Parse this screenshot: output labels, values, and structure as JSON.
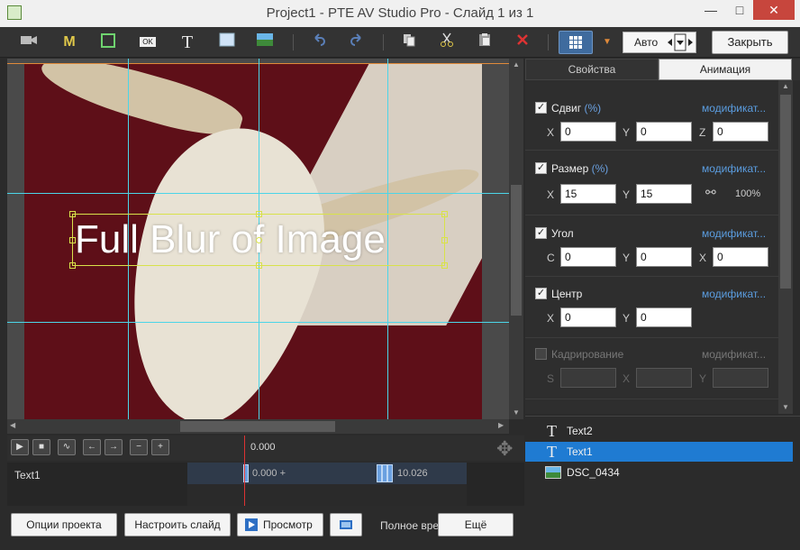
{
  "window": {
    "title": "Project1 - PTE AV Studio Pro - Слайд 1 из 1",
    "close_glyph": "✕",
    "minimize_glyph": "—",
    "maximize_glyph": "□"
  },
  "toolbar": {
    "icons": [
      "camera-icon",
      "mask-icon",
      "frame-icon",
      "ok-button-icon",
      "text-icon",
      "rectangle-icon",
      "image-icon",
      "undo-icon",
      "redo-icon",
      "copy-icon",
      "cut-icon",
      "paste-icon",
      "delete-icon",
      "grid-icon"
    ],
    "mask_glyph": "M",
    "text_glyph": "T",
    "ok_glyph": "OK",
    "mode_value": "Авто",
    "close_label": "Закрыть"
  },
  "canvas": {
    "text_object": "Full Blur of Image"
  },
  "tabs": [
    {
      "label": "Свойства",
      "active": false
    },
    {
      "label": "Анимация",
      "active": true
    }
  ],
  "props": {
    "modifier_label": "модификат...",
    "sections": [
      {
        "name": "pan",
        "label": "Сдвиг",
        "suffix": "(%)",
        "checked": true,
        "fields": [
          {
            "axis": "X",
            "value": "0"
          },
          {
            "axis": "Y",
            "value": "0"
          },
          {
            "axis": "Z",
            "value": "0"
          }
        ]
      },
      {
        "name": "zoom",
        "label": "Размер",
        "suffix": "(%)",
        "checked": true,
        "fields": [
          {
            "axis": "X",
            "value": "15"
          },
          {
            "axis": "Y",
            "value": "15"
          }
        ],
        "ratio": "100%"
      },
      {
        "name": "rotation",
        "label": "Угол",
        "suffix": "",
        "checked": true,
        "fields": [
          {
            "axis": "C",
            "value": "0"
          },
          {
            "axis": "Y",
            "value": "0"
          },
          {
            "axis": "X",
            "value": "0"
          }
        ]
      },
      {
        "name": "center",
        "label": "Центр",
        "suffix": "",
        "checked": true,
        "fields": [
          {
            "axis": "X",
            "value": "0"
          },
          {
            "axis": "Y",
            "value": "0"
          }
        ]
      },
      {
        "name": "crop",
        "label": "Кадрирование",
        "suffix": "",
        "checked": false,
        "fields": [
          {
            "axis": "S",
            "value": ""
          },
          {
            "axis": "X",
            "value": ""
          },
          {
            "axis": "Y",
            "value": ""
          }
        ]
      }
    ]
  },
  "layers": [
    {
      "name": "Text2",
      "type": "text",
      "selected": false
    },
    {
      "name": "Text1",
      "type": "text",
      "selected": true
    },
    {
      "name": "DSC_0434",
      "type": "image",
      "selected": false
    }
  ],
  "timeline": {
    "current_time": "0.000",
    "track_name": "Text1",
    "start_label": "0.000 +",
    "end_label": "10.026",
    "buttons": [
      "▶",
      "■",
      "∿",
      "←",
      "→",
      "−",
      "+"
    ]
  },
  "bottom": {
    "project_options": "Опции проекта",
    "slide_options": "Настроить слайд",
    "preview": "Просмотр",
    "full_label": "Полное вре",
    "more": "Ещё"
  },
  "colors": {
    "accent": "#1f7bd2",
    "guide": "#4bd5e8",
    "selection": "#d8e24a",
    "link": "#5b9de0"
  }
}
